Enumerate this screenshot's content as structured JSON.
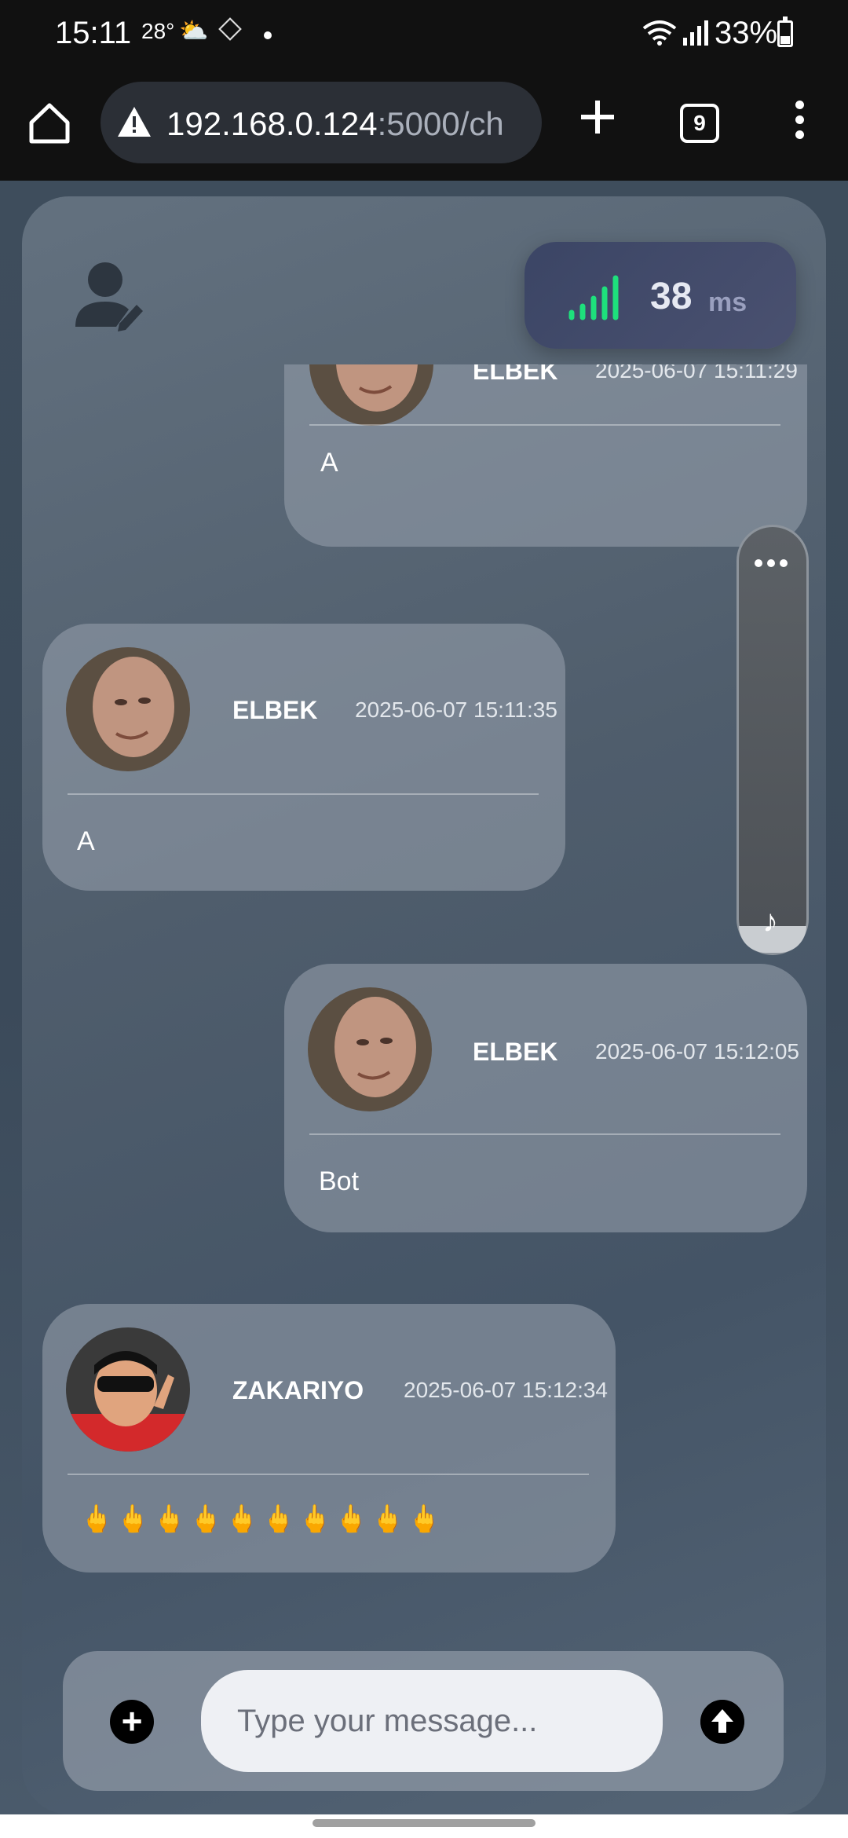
{
  "status_bar": {
    "time": "15:11",
    "temperature": "28°",
    "battery": "33%",
    "icons": [
      "weather-icon",
      "app-notification-icon",
      "wifi-icon",
      "signal-icon",
      "battery-icon"
    ]
  },
  "browser": {
    "url_main": "192.168.0.124",
    "url_rest": ":5000/ch",
    "tab_count": "9"
  },
  "header": {
    "ping_value": "38",
    "ping_unit": "ms",
    "ping_color": "#1ee07c"
  },
  "messages": [
    {
      "name": "ELBEK",
      "time": "2025-06-07 15:11:29",
      "text": "A",
      "side": "right"
    },
    {
      "name": "ELBEK",
      "time": "2025-06-07 15:11:35",
      "text": "A",
      "side": "left"
    },
    {
      "name": "ELBEK",
      "time": "2025-06-07 15:12:05",
      "text": "Bot",
      "side": "right"
    },
    {
      "name": "ZAKARIYO",
      "time": "2025-06-07 15:12:34",
      "text": "🖕🖕🖕🖕🖕🖕🖕🖕🖕🖕",
      "side": "left"
    }
  ],
  "composer": {
    "placeholder": "Type your message..."
  }
}
